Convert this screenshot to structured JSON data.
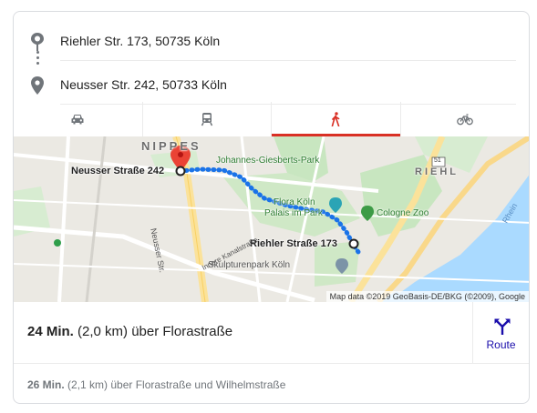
{
  "route": {
    "origin": "Riehler Str. 173, 50735 Köln",
    "destination": "Neusser Str. 242, 50733 Köln"
  },
  "icons": {
    "origin": "origin-pin-icon",
    "destination": "destination-pin-icon",
    "route": "route-icon"
  },
  "tabs": [
    {
      "name": "car",
      "icon": "car-icon",
      "active": false
    },
    {
      "name": "transit",
      "icon": "train-icon",
      "active": false
    },
    {
      "name": "walking",
      "icon": "walking-icon",
      "active": true
    },
    {
      "name": "bicycle",
      "icon": "bicycle-icon",
      "active": false
    }
  ],
  "colors": {
    "accent": "#d93025",
    "route_line": "#1a73e8",
    "link": "#1a0dab",
    "water": "#aadaff",
    "park": "#c8e6c0"
  },
  "map": {
    "district_1": "NIPPES",
    "district_2": "RIEHL",
    "start_label": "Neusser Straße 242",
    "end_label": "Riehler Straße 173",
    "poi_park": "Johannes-Giesberts-Park",
    "poi_flora_1": "Flora Köln",
    "poi_flora_2": "Palais im Park",
    "poi_zoo": "Cologne Zoo",
    "poi_skulptur": "Skulpturenpark Köln",
    "street_neusser": "Neusser Str.",
    "street_kanal": "Innere Kanalstraße",
    "river": "Rhein",
    "road_shield": "51",
    "attribution": "Map data ©2019 GeoBasis-DE/BKG (©2009), Google"
  },
  "primary_route": {
    "duration": "24 Min.",
    "details": "(2,0 km) über Florastraße",
    "button_label": "Route"
  },
  "alt_route": {
    "duration": "26 Min.",
    "details": "(2,1 km) über Florastraße und Wilhelmstraße"
  }
}
